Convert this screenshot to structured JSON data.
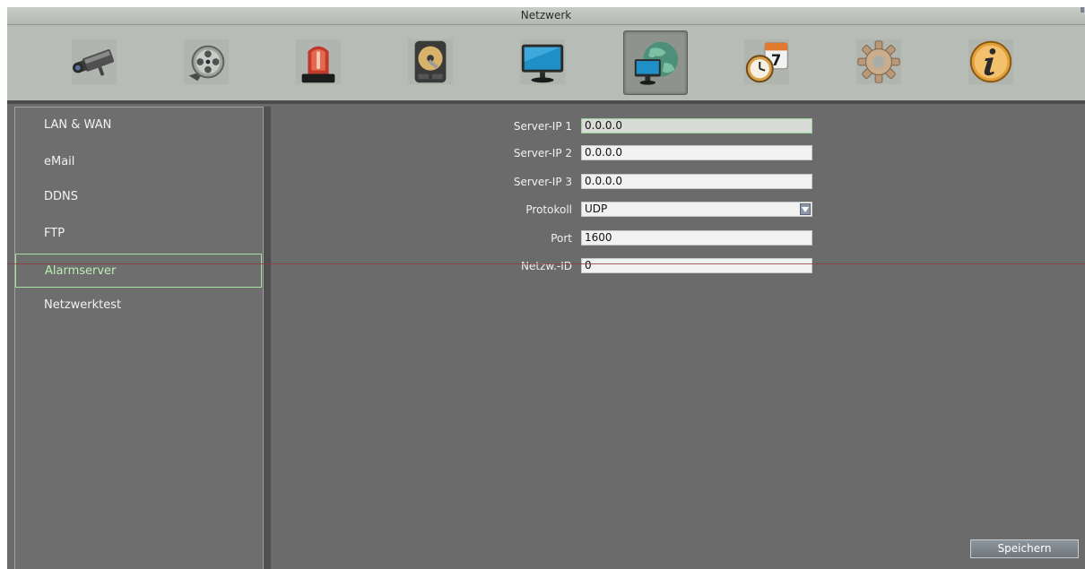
{
  "window": {
    "title": "Netzwerk"
  },
  "toolbar": {
    "icons": [
      {
        "name": "camera-icon",
        "active": false
      },
      {
        "name": "film-reel-icon",
        "active": false
      },
      {
        "name": "alarm-siren-icon",
        "active": false
      },
      {
        "name": "hard-disk-icon",
        "active": false
      },
      {
        "name": "monitor-icon",
        "active": false
      },
      {
        "name": "network-globe-icon",
        "active": true
      },
      {
        "name": "clock-calendar-icon",
        "active": false
      },
      {
        "name": "gear-icon",
        "active": false
      },
      {
        "name": "info-icon",
        "active": false
      }
    ],
    "calendar_day": "7"
  },
  "sidebar": {
    "items": [
      {
        "label": "LAN & WAN"
      },
      {
        "label": "eMail"
      },
      {
        "label": "DDNS"
      },
      {
        "label": "FTP"
      },
      {
        "label": "Alarmserver",
        "selected": true
      },
      {
        "label": "Netzwerktest"
      }
    ]
  },
  "form": {
    "server_ip_1": {
      "label": "Server-IP 1",
      "value": "0.0.0.0"
    },
    "server_ip_2": {
      "label": "Server-IP 2",
      "value": "0.0.0.0"
    },
    "server_ip_3": {
      "label": "Server-IP 3",
      "value": "0.0.0.0"
    },
    "protokoll": {
      "label": "Protokoll",
      "value": "UDP"
    },
    "port": {
      "label": "Port",
      "value": "1600"
    },
    "netzw_id": {
      "label": "Netzw.-ID",
      "value": "0"
    }
  },
  "buttons": {
    "save_label": "Speichern"
  },
  "colors": {
    "selection": "#a7e0a0",
    "panel": "#6b6b6b",
    "toolbar": "#b8bcb6"
  }
}
